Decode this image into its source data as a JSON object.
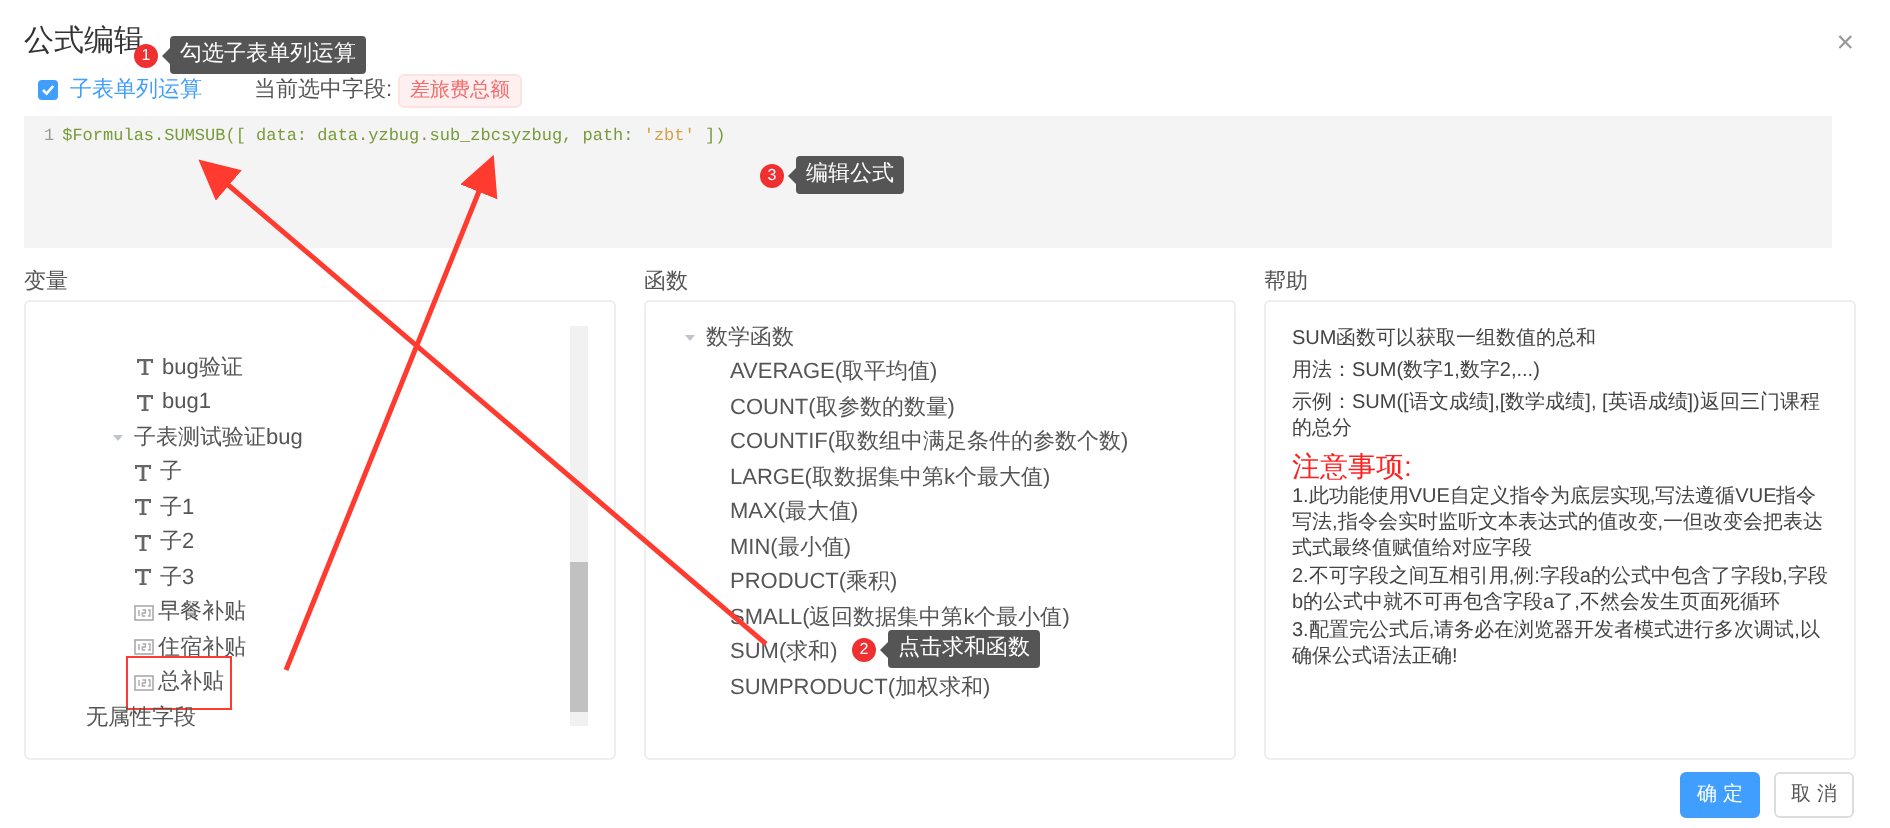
{
  "dialog": {
    "title": "公式编辑",
    "close": "×"
  },
  "options": {
    "checkbox": {
      "label": "子表单列运算",
      "checked": true
    },
    "current_field_label": "当前选中字段:",
    "current_field": "差旅费总额"
  },
  "editor": {
    "line_number": "1",
    "tokens": [
      {
        "text": "$Formulas.SUMSUB([ data: data.yzbug.sub_zbcsyzbug, path: ",
        "kind": "code"
      },
      {
        "text": "'zbt'",
        "kind": "string"
      },
      {
        "text": " ])",
        "kind": "code"
      }
    ]
  },
  "variables": {
    "title": "变量",
    "items": [
      {
        "label": "bug验证",
        "kind": "text",
        "highlighted": false
      },
      {
        "label": "bug1",
        "kind": "text",
        "highlighted": false
      },
      {
        "label": "子表测试验证bug",
        "kind": "group",
        "expanded": true,
        "highlighted": false,
        "children": [
          {
            "label": "子",
            "kind": "text",
            "highlighted": false
          },
          {
            "label": "子1",
            "kind": "text",
            "highlighted": false
          },
          {
            "label": "子2",
            "kind": "text",
            "highlighted": false
          },
          {
            "label": "子3",
            "kind": "text",
            "highlighted": false
          },
          {
            "label": "早餐补贴",
            "kind": "number",
            "highlighted": false
          },
          {
            "label": "住宿补贴",
            "kind": "number",
            "highlighted": false
          },
          {
            "label": "总补贴",
            "kind": "number",
            "highlighted": true
          }
        ]
      },
      {
        "label": "无属性字段",
        "kind": "section",
        "highlighted": false
      }
    ]
  },
  "functions": {
    "title": "函数",
    "groups": [
      {
        "label": "数学函数",
        "expanded": true,
        "children": [
          {
            "label": "AVERAGE(取平均值)"
          },
          {
            "label": "COUNT(取参数的数量)"
          },
          {
            "label": "COUNTIF(取数组中满足条件的参数个数)"
          },
          {
            "label": "LARGE(取数据集中第k个最大值)"
          },
          {
            "label": "MAX(最大值)"
          },
          {
            "label": "MIN(最小值)"
          },
          {
            "label": "PRODUCT(乘积)"
          },
          {
            "label": "SMALL(返回数据集中第k个最小值)"
          },
          {
            "label": "SUM(求和)"
          },
          {
            "label": "SUMPRODUCT(加权求和)"
          }
        ]
      }
    ]
  },
  "help": {
    "title": "帮助",
    "intro": [
      "SUM函数可以获取一组数值的总和",
      "用法：SUM(数字1,数字2,...)",
      "示例：SUM([语文成绩],[数学成绩], [英语成绩])返回三门课程的总分"
    ],
    "notes_title": "注意事项:",
    "notes": [
      "1.此功能使用VUE自定义指令为底层实现,写法遵循VUE指令写法,指令会实时监听文本表达式的值改变,一但改变会把表达式式最终值赋值给对应字段",
      "2.不可字段之间互相引用,例:字段a的公式中包含了字段b,字段b的公式中就不可再包含字段a了,不然会发生页面死循环",
      "3.配置完公式后,请务必在浏览器开发者模式进行多次调试,以确保公式语法正确!"
    ]
  },
  "buttons": [
    {
      "label": "确 定",
      "kind": "primary"
    },
    {
      "label": "取 消",
      "kind": "default"
    }
  ],
  "callouts": [
    {
      "number": "1",
      "text": "勾选子表单列运算"
    },
    {
      "number": "2",
      "text": "点击求和函数"
    },
    {
      "number": "3",
      "text": "编辑公式"
    }
  ]
}
